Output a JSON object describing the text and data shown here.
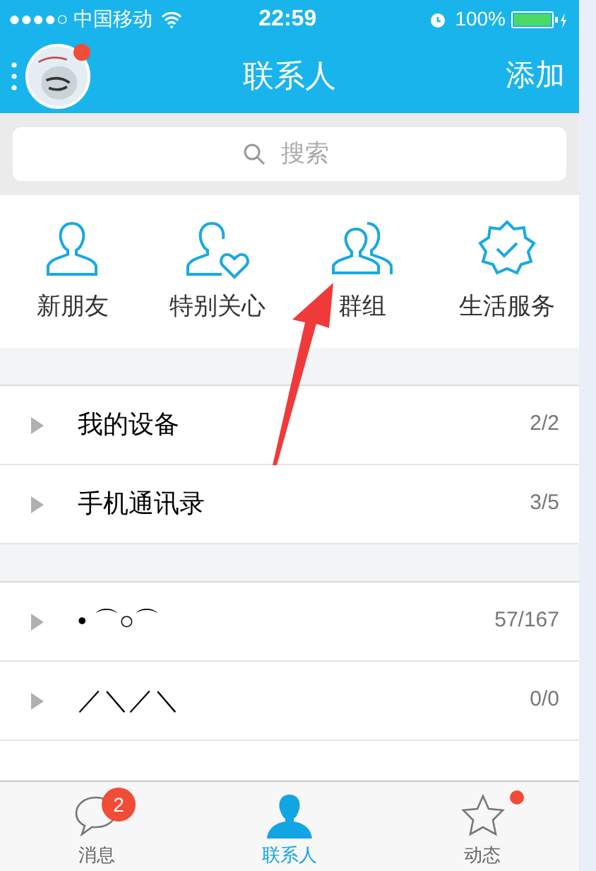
{
  "status_bar": {
    "carrier": "●●●●○ 中国移动",
    "time": "22:59",
    "battery": "100%"
  },
  "nav": {
    "title": "联系人",
    "action": "添加",
    "avatar_badge": true
  },
  "search": {
    "placeholder": "搜索"
  },
  "shortcuts": [
    {
      "label": "新朋友",
      "kind": "person"
    },
    {
      "label": "特别关心",
      "kind": "heart"
    },
    {
      "label": "群组",
      "kind": "group"
    },
    {
      "label": "生活服务",
      "kind": "badge"
    }
  ],
  "sections": [
    [
      {
        "name": "我的设备",
        "count": "2/2"
      },
      {
        "name": "手机通讯录",
        "count": "3/5"
      }
    ],
    [
      {
        "name": "•  ⌒○⌒",
        "count": "57/167"
      },
      {
        "name": "／＼／＼",
        "count": "0/0"
      }
    ]
  ],
  "tab_bar": [
    {
      "label": "消息",
      "kind": "chat",
      "selected": false,
      "badge": "2",
      "dot": false
    },
    {
      "label": "联系人",
      "kind": "contact",
      "selected": true,
      "dot": false
    },
    {
      "label": "动态",
      "kind": "star",
      "selected": false,
      "dot": true
    }
  ]
}
